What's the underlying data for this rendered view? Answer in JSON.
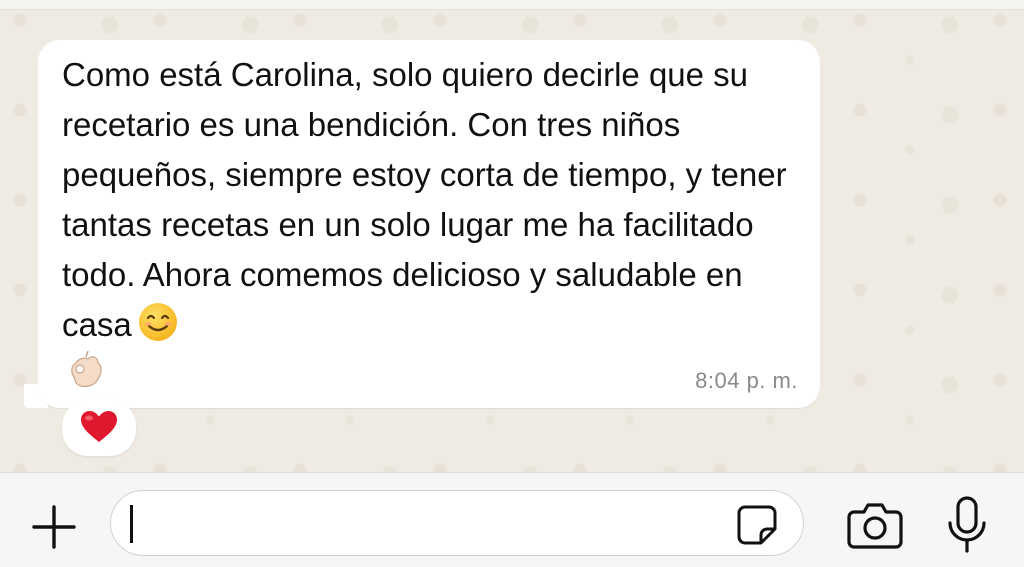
{
  "conversation": {
    "message": {
      "text": "Como está Carolina, solo quiero decirle que su recetario es una bendición. Con tres niños pequeños, siempre estoy corta de tiempo, y tener tantas recetas en un solo lugar me ha facilitado todo. Ahora comemos delicioso y saludable en casa",
      "emojis": [
        "smiling-face-with-smiling-eyes",
        "ok-hand-light-skin-tone"
      ],
      "time": "8:04 p. m.",
      "reaction": "red-heart"
    }
  },
  "composer": {
    "value": "",
    "placeholder": "",
    "icons": [
      "plus-icon",
      "sticker-icon",
      "camera-icon",
      "microphone-icon"
    ]
  },
  "colors": {
    "chat_background": "#efeae2",
    "bubble": "#ffffff",
    "text": "#111111",
    "timestamp": "#8a8a8a",
    "heart": "#e0182d",
    "emoji_yellow": "#f9c12c"
  }
}
